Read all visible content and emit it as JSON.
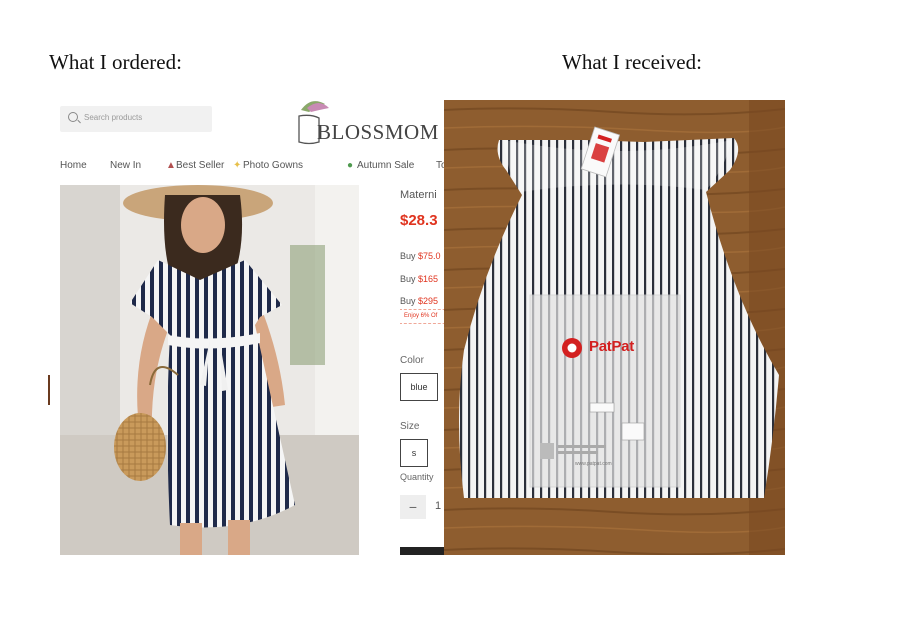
{
  "headings": {
    "ordered": "What I ordered:",
    "received": "What I received:"
  },
  "store": {
    "search_placeholder": "Search products",
    "logo_text": "BLOSSMOM",
    "nav": [
      "Home",
      "New In",
      "Best Seller",
      "Photo Gowns",
      "Autumn Sale",
      "To"
    ],
    "product_title_partial": "Materni",
    "price_partial": "$28.3",
    "tiers": [
      {
        "prefix": "Buy ",
        "amount": "$75.0"
      },
      {
        "prefix": "Buy ",
        "amount": "$165"
      },
      {
        "prefix": "Buy ",
        "amount": "$295"
      }
    ],
    "enjoy_partial": "Enjoy 6% Of",
    "color_label": "Color",
    "color_value": "blue",
    "size_label": "Size",
    "size_value": "s",
    "quantity_label": "Quantity",
    "quantity_minus": "−",
    "quantity_value": "1"
  },
  "received_photo": {
    "bag_brand": "PatPat",
    "bag_url": "www.patpat.com",
    "tag_brand": "PatPat"
  },
  "colors": {
    "price_red": "#e0341f",
    "stripe_navy": "#1f2a4a",
    "table_wood": "#8a5a2e",
    "patpat_red": "#d32020"
  }
}
